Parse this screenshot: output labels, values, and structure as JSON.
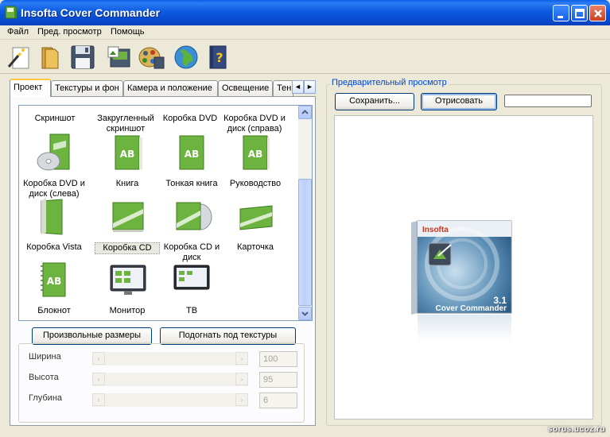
{
  "window": {
    "title": "Insofta Cover Commander"
  },
  "menu": {
    "items": [
      "Файл",
      "Пред. просмотр",
      "Помощь"
    ]
  },
  "toolbar": {
    "tools": [
      "new-wizard-icon",
      "open-folder-icon",
      "save-floppy-icon",
      "export-image-icon",
      "render-film-icon",
      "website-globe-icon",
      "help-book-icon"
    ]
  },
  "tabs": {
    "items": [
      "Проект",
      "Текстуры и фон",
      "Камера и положение",
      "Освещение",
      "Тен"
    ],
    "active": "Проект",
    "scroll_left": "◄",
    "scroll_right": "►"
  },
  "gallery": {
    "items": [
      {
        "label": "Скриншот",
        "icon": "screenshot-icon"
      },
      {
        "label": "Закругленный скриншот",
        "icon": "rounded-screenshot-icon"
      },
      {
        "label": "Коробка DVD",
        "icon": "dvd-box-icon"
      },
      {
        "label": "Коробка DVD и диск (справа)",
        "icon": "dvd-box-disc-right-icon"
      },
      {
        "label": "Коробка DVD и диск (слева)",
        "icon": "dvd-box-disc-left-icon"
      },
      {
        "label": "Книга",
        "icon": "book-icon"
      },
      {
        "label": "Тонкая книга",
        "icon": "thin-book-icon"
      },
      {
        "label": "Руководство",
        "icon": "manual-icon"
      },
      {
        "label": "Коробка Vista",
        "icon": "vista-box-icon"
      },
      {
        "label": "Коробка CD",
        "icon": "cd-box-icon",
        "selected": true
      },
      {
        "label": "Коробка CD и диск",
        "icon": "cd-box-disc-icon"
      },
      {
        "label": "Карточка",
        "icon": "card-icon"
      },
      {
        "label": "Блокнот",
        "icon": "notebook-icon"
      },
      {
        "label": "Монитор",
        "icon": "monitor-icon"
      },
      {
        "label": "ТВ",
        "icon": "tv-icon"
      }
    ]
  },
  "buttons": {
    "custom_sizes": "Произвольные размеры",
    "fit_textures": "Подогнать под текстуры",
    "save": "Сохранить...",
    "render": "Отрисовать"
  },
  "dimensions": {
    "width_label": "Ширина",
    "width_value": "100",
    "height_label": "Высота",
    "height_value": "95",
    "depth_label": "Глубина",
    "depth_value": "6"
  },
  "preview": {
    "label": "Предварительный просмотр",
    "cover_brand": "Insofta",
    "cover_version": "3.1",
    "cover_product": "Cover Commander",
    "render_progress": 0
  },
  "watermark": "sorus.ucoz.ru",
  "colors": {
    "title_bar": "#0a5fe6",
    "window_bg": "#ece9d8",
    "accent_green": "#6db33f",
    "preview_label": "#0046d5"
  }
}
